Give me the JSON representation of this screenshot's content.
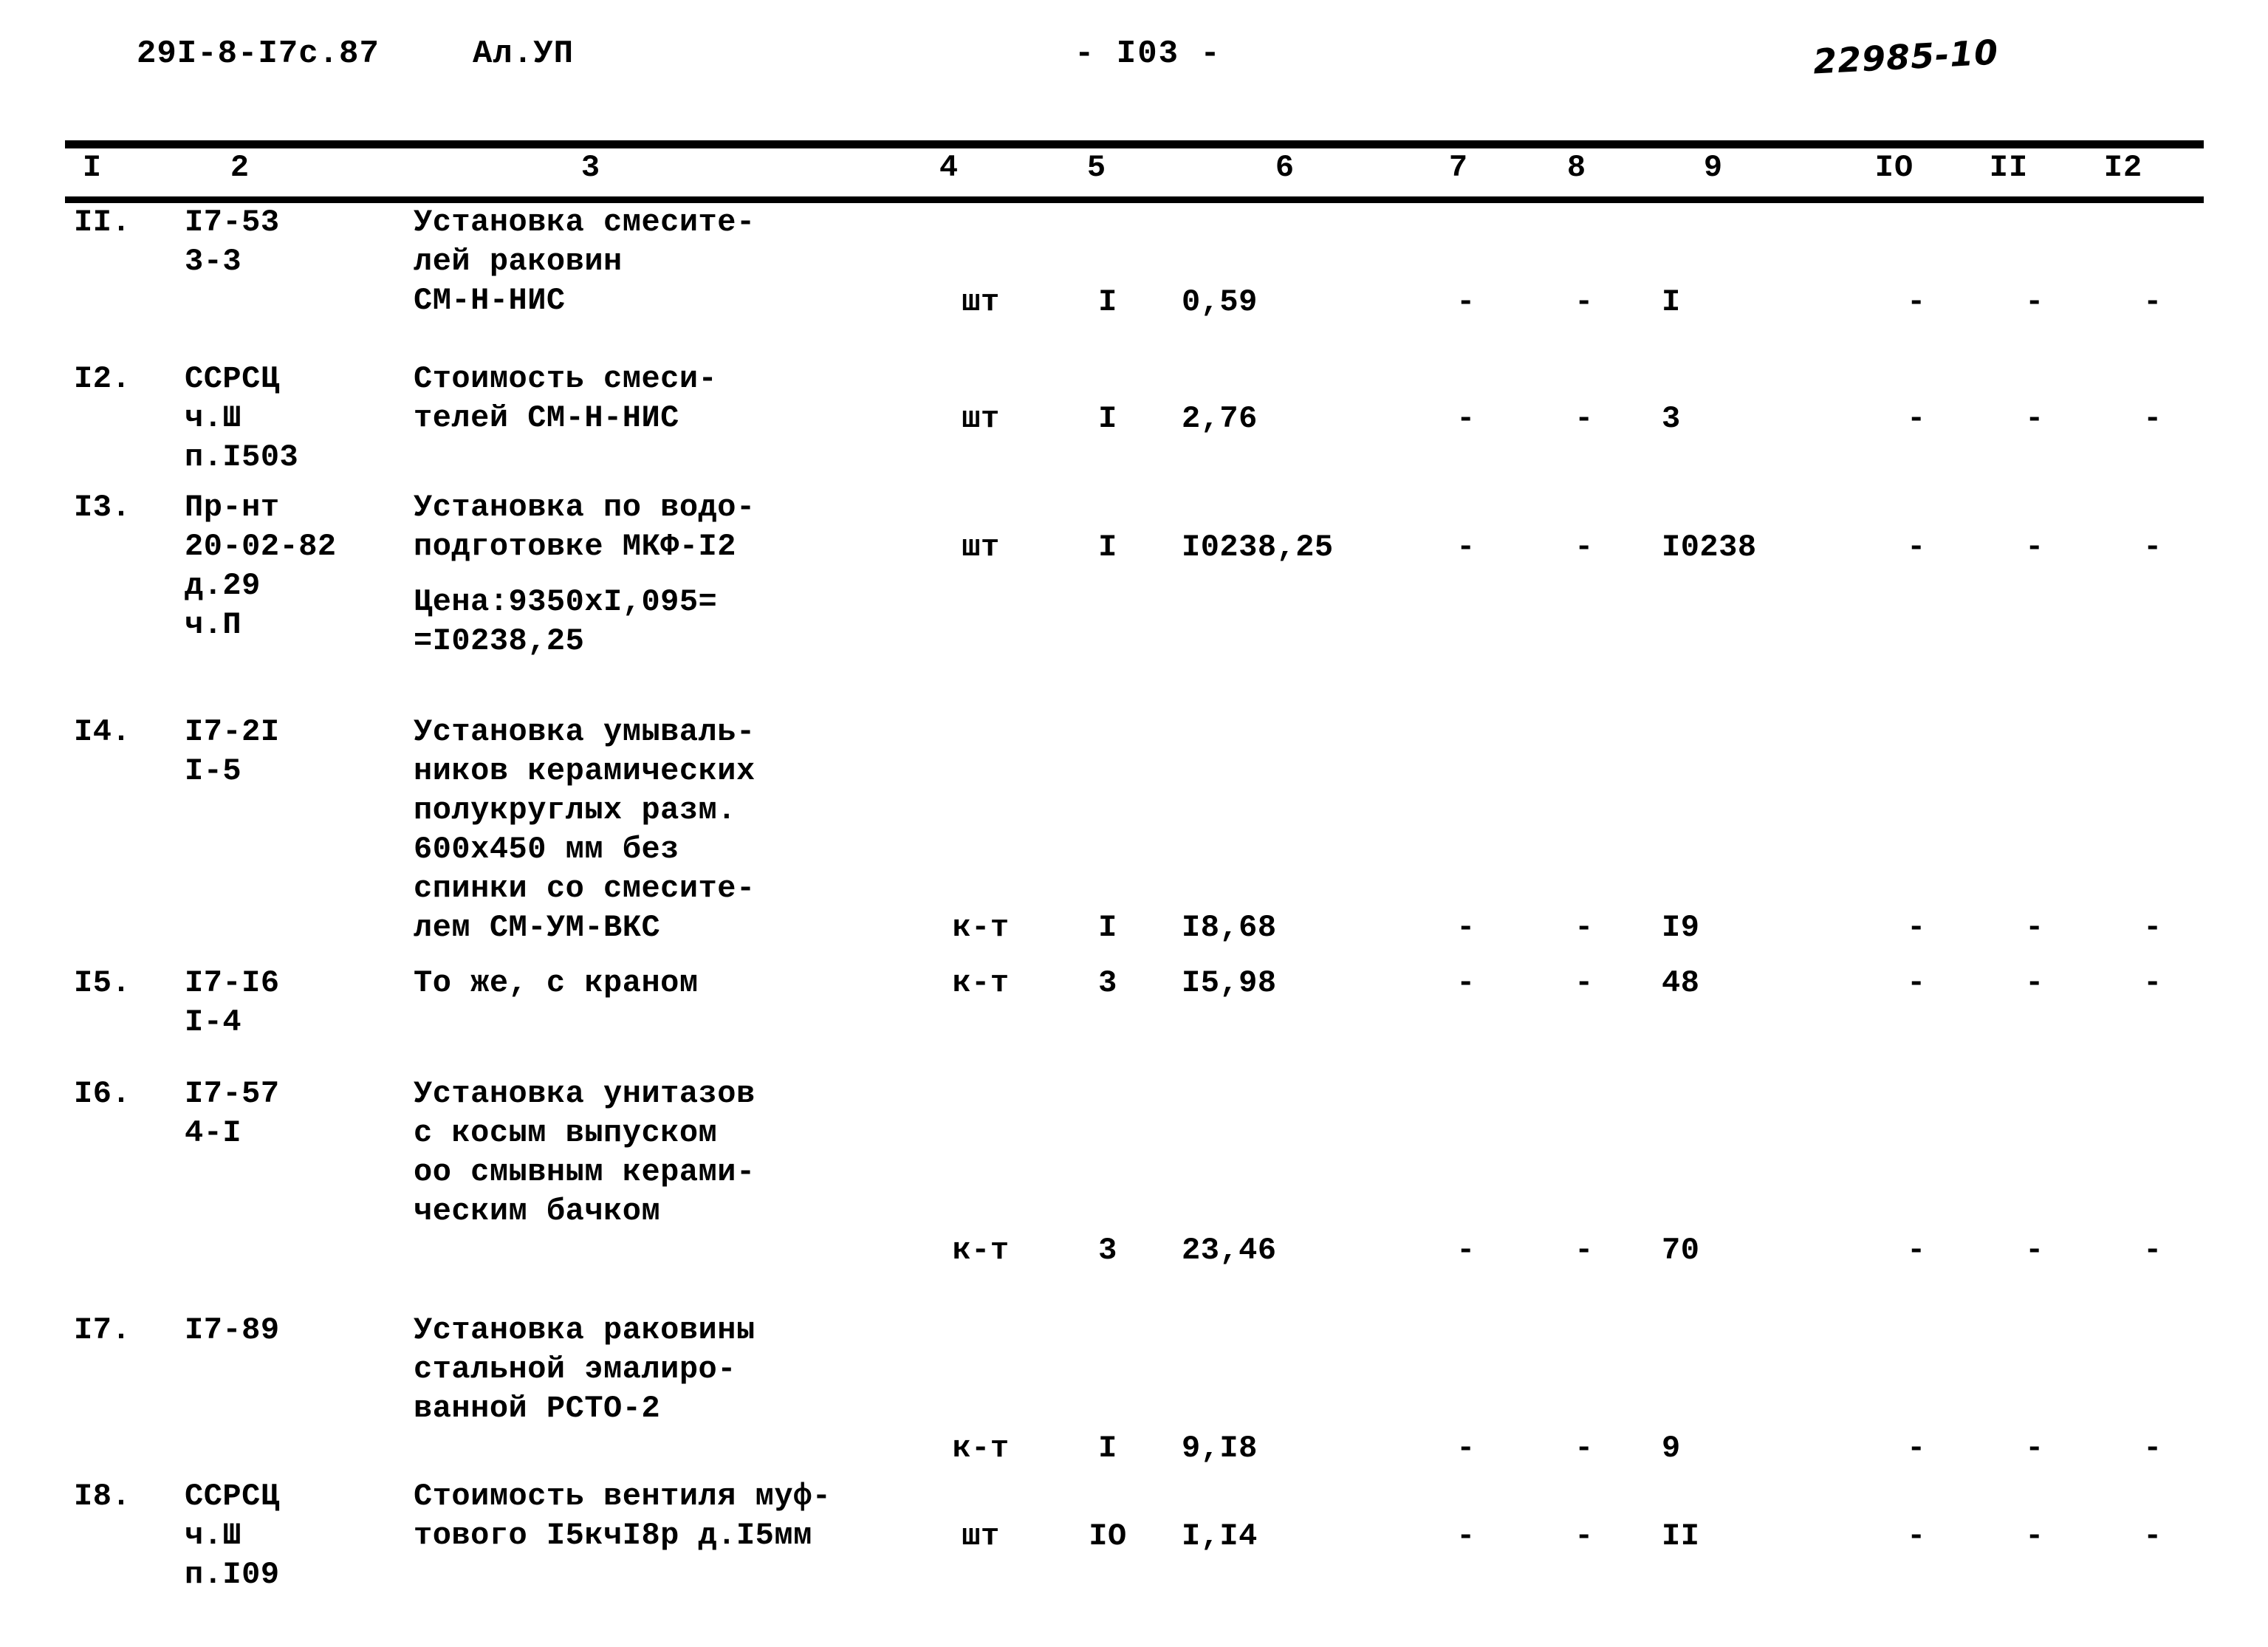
{
  "header": {
    "doc_code": "29I-8-I7c.87",
    "album": "Ал.УП",
    "page_number": "- I03 -",
    "stamp": "22985-10"
  },
  "table": {
    "column_numbers": [
      "I",
      "2",
      "3",
      "4",
      "5",
      "6",
      "7",
      "8",
      "9",
      "IO",
      "II",
      "I2"
    ],
    "rows": [
      {
        "num": "II.",
        "code": "I7-53\n3-3",
        "desc": "Установка смесите-\nлей раковин\nСМ-Н-НИС",
        "unit": "шт",
        "qty": "I",
        "price": "0,59",
        "c7": "-",
        "c8": "-",
        "c9": "I",
        "c10": "-",
        "c11": "-",
        "c12": "-"
      },
      {
        "num": "I2.",
        "code": "ССРСЦ\nч.Ш\nп.I503",
        "desc": "Стоимость смеси-\nтелей СМ-Н-НИС",
        "unit": "шт",
        "qty": "I",
        "price": "2,76",
        "c7": "-",
        "c8": "-",
        "c9": "3",
        "c10": "-",
        "c11": "-",
        "c12": "-"
      },
      {
        "num": "I3.",
        "code": "Пр-нт\n20-02-82\nд.29\nч.П",
        "desc": "Установка по водо-\nподготовке МКФ-I2",
        "desc_note": "Цена:9350xI,095=\n=I0238,25",
        "unit": "шт",
        "qty": "I",
        "price": "I0238,25",
        "c7": "-",
        "c8": "-",
        "c9": "I0238",
        "c10": "-",
        "c11": "-",
        "c12": "-"
      },
      {
        "num": "I4.",
        "code": "I7-2I\nI-5",
        "desc": "Установка умываль-\nников керамических\nполукруглых разм.\n600x450 мм без\nспинки со смесите-\nлем СМ-УМ-ВКС",
        "unit": "к-т",
        "qty": "I",
        "price": "I8,68",
        "c7": "-",
        "c8": "-",
        "c9": "I9",
        "c10": "-",
        "c11": "-",
        "c12": "-"
      },
      {
        "num": "I5.",
        "code": "I7-I6\nI-4",
        "desc": "То же, с краном",
        "unit": "к-т",
        "qty": "3",
        "price": "I5,98",
        "c7": "-",
        "c8": "-",
        "c9": "48",
        "c10": "-",
        "c11": "-",
        "c12": "-"
      },
      {
        "num": "I6.",
        "code": "I7-57\n4-I",
        "desc": "Установка унитазов\nс косым выпуском\nоо смывным керами-\nческим бачком",
        "unit": "к-т",
        "qty": "3",
        "price": "23,46",
        "c7": "-",
        "c8": "-",
        "c9": "70",
        "c10": "-",
        "c11": "-",
        "c12": "-"
      },
      {
        "num": "I7.",
        "code": "I7-89",
        "desc": "Установка раковины\nстальной эмалиро-\nванной РСТО-2",
        "unit": "к-т",
        "qty": "I",
        "price": "9,I8",
        "c7": "-",
        "c8": "-",
        "c9": "9",
        "c10": "-",
        "c11": "-",
        "c12": "-"
      },
      {
        "num": "I8.",
        "code": "ССРСЦ\nч.Ш\nп.I09",
        "desc": "Стоимость вентиля муф-\nтового I5кчI8р д.I5мм",
        "unit": "шт",
        "qty": "IO",
        "price": "I,I4",
        "c7": "-",
        "c8": "-",
        "c9": "II",
        "c10": "-",
        "c11": "-",
        "c12": "-"
      }
    ]
  }
}
